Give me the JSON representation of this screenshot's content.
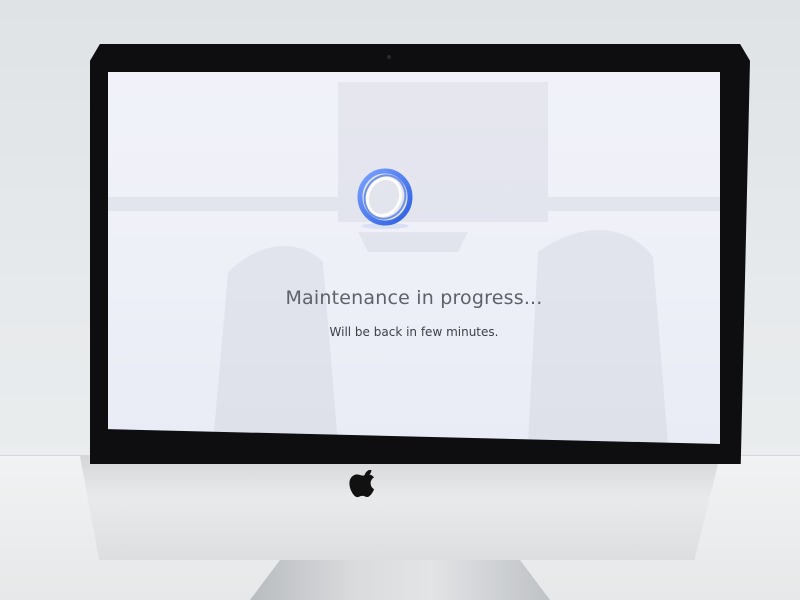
{
  "screen": {
    "title": "Maintenance in progress...",
    "subtitle": "Will be back in few minutes."
  },
  "icons": {
    "loader": "ring-spinner-icon",
    "brand": "apple-logo-icon"
  },
  "colors": {
    "screen_background": "#eef0f8",
    "spinner_accent": "#3b6ee8",
    "title_text": "#5f6068",
    "subtitle_text": "#3e3f45",
    "bezel": "#0e0e10"
  }
}
